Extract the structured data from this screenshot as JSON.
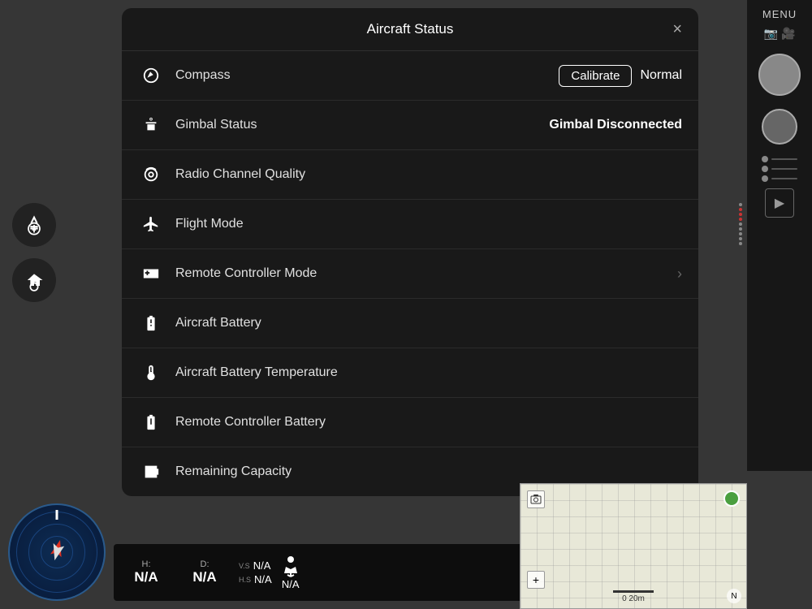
{
  "modal": {
    "title": "Aircraft Status",
    "close_label": "×",
    "rows": [
      {
        "id": "compass",
        "label": "Compass",
        "value": "Normal",
        "has_calibrate": true,
        "calibrate_label": "Calibrate",
        "has_chevron": false
      },
      {
        "id": "gimbal",
        "label": "Gimbal Status",
        "value": "Gimbal Disconnected",
        "value_bold": true,
        "has_calibrate": false,
        "has_chevron": false
      },
      {
        "id": "radio",
        "label": "Radio Channel Quality",
        "value": "",
        "has_calibrate": false,
        "has_chevron": false
      },
      {
        "id": "flight-mode",
        "label": "Flight Mode",
        "value": "",
        "has_calibrate": false,
        "has_chevron": false
      },
      {
        "id": "rc-mode",
        "label": "Remote Controller Mode",
        "value": "",
        "has_calibrate": false,
        "has_chevron": true
      },
      {
        "id": "aircraft-battery",
        "label": "Aircraft Battery",
        "value": "",
        "has_calibrate": false,
        "has_chevron": false
      },
      {
        "id": "battery-temp",
        "label": "Aircraft Battery Temperature",
        "value": "",
        "has_calibrate": false,
        "has_chevron": false
      },
      {
        "id": "rc-battery",
        "label": "Remote Controller Battery",
        "value": "",
        "has_calibrate": false,
        "has_chevron": false
      },
      {
        "id": "remaining-capacity",
        "label": "Remaining Capacity",
        "value": "",
        "has_calibrate": false,
        "has_chevron": false
      }
    ]
  },
  "menu": {
    "label": "MENU"
  },
  "telemetry": {
    "h_label": "H:",
    "h_value": "N/A",
    "d_label": "D:",
    "d_value": "N/A",
    "vs_label": "V.S",
    "vs_value": "N/A",
    "hs_label": "H.S",
    "hs_value": "N/A",
    "person_value": "N/A"
  },
  "map": {
    "scale_label": "0    20m"
  },
  "colors": {
    "accent": "#ffffff",
    "danger": "#cc3333",
    "modal_bg": "rgba(25,25,25,0.97)"
  }
}
